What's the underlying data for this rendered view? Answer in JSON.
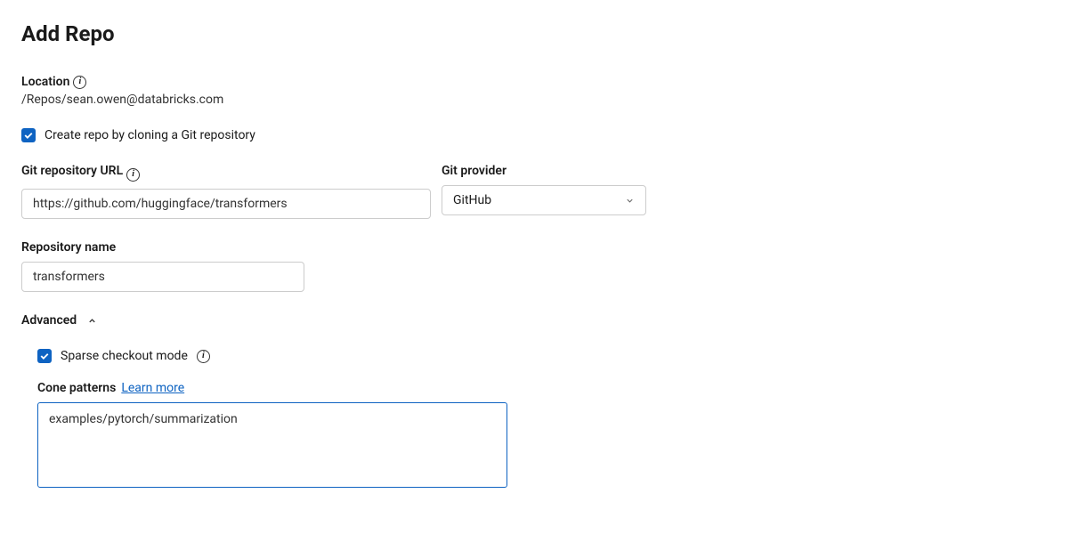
{
  "title": "Add Repo",
  "location": {
    "label": "Location",
    "path": "/Repos/sean.owen@databricks.com"
  },
  "createByClone": {
    "checked": true,
    "label": "Create repo by cloning a Git repository"
  },
  "gitUrl": {
    "label": "Git repository URL",
    "value": "https://github.com/huggingface/transformers"
  },
  "gitProvider": {
    "label": "Git provider",
    "selected": "GitHub"
  },
  "repoName": {
    "label": "Repository name",
    "value": "transformers"
  },
  "advanced": {
    "label": "Advanced",
    "expanded": true,
    "sparseCheckout": {
      "label": "Sparse checkout mode",
      "checked": true
    },
    "conePatterns": {
      "label": "Cone patterns",
      "learnMore": "Learn more",
      "value": "examples/pytorch/summarization"
    }
  }
}
